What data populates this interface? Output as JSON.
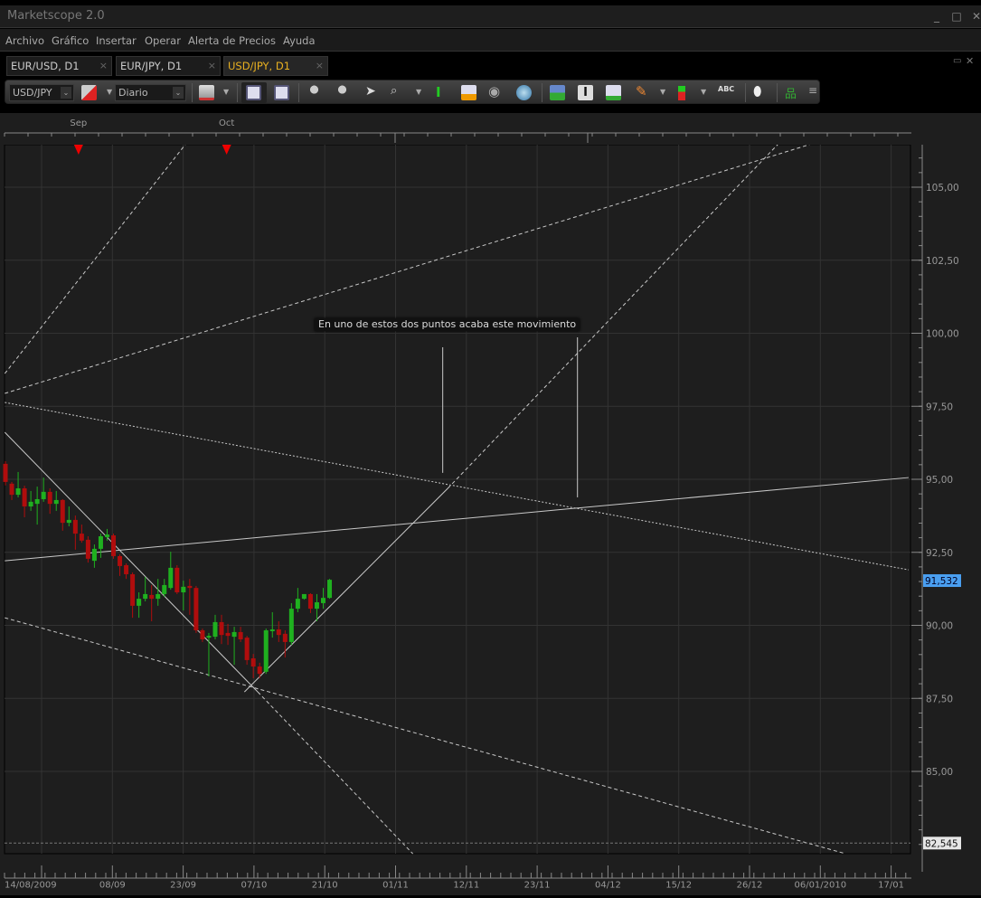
{
  "window": {
    "title": "Marketscope 2.0",
    "minimize": "_",
    "maximize": "□",
    "close": "✕"
  },
  "menu": [
    "Archivo",
    "Gráfico",
    "Insertar",
    "Operar",
    "Alerta de Precios",
    "Ayuda"
  ],
  "tabs": [
    {
      "label": "EUR/USD, D1",
      "active": false
    },
    {
      "label": "EUR/JPY, D1",
      "active": false
    },
    {
      "label": "USD/JPY, D1",
      "active": true
    }
  ],
  "tab_close": "×",
  "toolbar": {
    "symbol": "USD/JPY",
    "timeframe": "Diario",
    "dropdown": "⌄"
  },
  "colors": {
    "bull": "#1fb01f",
    "bear": "#b00d0d",
    "accent_tab": "#e8b020",
    "last_price_bg": "#4a9ff0",
    "line": "#c8c8c8",
    "grid": "#333333"
  },
  "chart_data": {
    "type": "candlestick",
    "symbol": "USD/JPY",
    "timeframe": "D1",
    "ylim": [
      82.1,
      106.5
    ],
    "y_ticks": [
      "105,00",
      "102,50",
      "100,00",
      "97,50",
      "95,00",
      "92,50",
      "90,00",
      "87,50",
      "85,00"
    ],
    "y_tick_values": [
      105,
      102.5,
      100,
      97.5,
      95,
      92.5,
      90,
      87.5,
      85
    ],
    "x_ticks": [
      "14/08/2009",
      "08/09",
      "23/09",
      "07/10",
      "21/10",
      "01/11",
      "12/11",
      "23/11",
      "04/12",
      "15/12",
      "26/12",
      "06/01/2010",
      "17/01"
    ],
    "top_months": [
      {
        "label": "Sep",
        "bar": 11.5
      },
      {
        "label": "Oct",
        "bar": 34.8
      }
    ],
    "last_price": "91,532",
    "last_price_value": 91.532,
    "hline_label": "82,545",
    "hline_value": 82.545,
    "annotation": {
      "text": "En uno de estos dos puntos acaba este movimiento",
      "bar": 70,
      "price": 100.29
    },
    "candles": [
      [
        95.53,
        95.62,
        94.79,
        94.91
      ],
      [
        94.85,
        94.91,
        94.29,
        94.47
      ],
      [
        94.47,
        95.25,
        94.38,
        94.69
      ],
      [
        94.69,
        94.78,
        93.7,
        94.07
      ],
      [
        94.07,
        94.6,
        93.92,
        94.23
      ],
      [
        94.16,
        94.75,
        93.45,
        94.32
      ],
      [
        94.32,
        95.06,
        94.23,
        94.57
      ],
      [
        94.57,
        94.69,
        93.82,
        94.16
      ],
      [
        94.16,
        94.6,
        93.92,
        94.29
      ],
      [
        94.29,
        94.32,
        93.24,
        93.51
      ],
      [
        93.51,
        94.07,
        93.39,
        93.61
      ],
      [
        93.61,
        93.76,
        92.59,
        93.14
      ],
      [
        93.14,
        93.45,
        92.83,
        92.9
      ],
      [
        92.93,
        93.05,
        92.15,
        92.28
      ],
      [
        92.21,
        92.77,
        91.97,
        92.62
      ],
      [
        92.62,
        93.14,
        92.31,
        93.05
      ],
      [
        93.02,
        93.3,
        92.9,
        93.11
      ],
      [
        93.08,
        93.14,
        92.28,
        92.37
      ],
      [
        92.37,
        92.43,
        91.69,
        92.03
      ],
      [
        92.06,
        92.12,
        91.59,
        91.75
      ],
      [
        91.75,
        91.81,
        90.26,
        90.67
      ],
      [
        90.67,
        91.13,
        90.26,
        90.91
      ],
      [
        90.91,
        91.66,
        90.82,
        91.07
      ],
      [
        91.04,
        91.38,
        90.14,
        90.91
      ],
      [
        90.91,
        91.59,
        90.67,
        91.07
      ],
      [
        91.07,
        91.59,
        90.98,
        91.38
      ],
      [
        91.28,
        92.52,
        91.22,
        91.97
      ],
      [
        91.97,
        92.06,
        91.07,
        91.13
      ],
      [
        91.13,
        91.53,
        90.51,
        91.32
      ],
      [
        91.35,
        91.59,
        90.36,
        91.28
      ],
      [
        91.28,
        91.35,
        89.74,
        89.83
      ],
      [
        89.83,
        89.89,
        89.43,
        89.52
      ],
      [
        89.58,
        89.74,
        88.25,
        89.64
      ],
      [
        89.61,
        90.36,
        89.52,
        90.11
      ],
      [
        90.11,
        90.36,
        89.36,
        89.67
      ],
      [
        89.74,
        90.05,
        89.33,
        89.64
      ],
      [
        89.61,
        89.95,
        88.65,
        89.77
      ],
      [
        89.77,
        89.95,
        89.43,
        89.52
      ],
      [
        89.58,
        89.64,
        88.65,
        88.81
      ],
      [
        88.87,
        89.02,
        88.19,
        88.59
      ],
      [
        88.59,
        88.72,
        88.19,
        88.34
      ],
      [
        88.41,
        89.89,
        88.34,
        89.83
      ],
      [
        89.8,
        90.45,
        89.58,
        89.86
      ],
      [
        89.86,
        90.14,
        89.43,
        89.67
      ],
      [
        89.71,
        89.83,
        88.9,
        89.43
      ],
      [
        89.43,
        90.76,
        89.33,
        90.57
      ],
      [
        90.57,
        91.28,
        90.45,
        90.91
      ],
      [
        90.91,
        91.07,
        90.88,
        91.07
      ],
      [
        91.07,
        91.1,
        90.42,
        90.57
      ],
      [
        90.57,
        91.07,
        90.14,
        90.79
      ],
      [
        90.76,
        91.28,
        90.57,
        90.94
      ],
      [
        90.94,
        91.59,
        90.91,
        91.56
      ]
    ],
    "trendlines": [
      {
        "from": [
          -0.1,
          98.62
        ],
        "to": [
          28.3,
          106.46
        ],
        "style": "dashed"
      },
      {
        "from": [
          -0.1,
          97.94
        ],
        "to": [
          126.5,
          106.46
        ],
        "style": "dashed"
      },
      {
        "from": [
          -0.1,
          97.63
        ],
        "to": [
          142.1,
          91.9
        ],
        "style": "dotted"
      },
      {
        "from": [
          -0.1,
          92.21
        ],
        "to": [
          142.1,
          95.06
        ],
        "style": "solid"
      },
      {
        "from": [
          -0.1,
          96.61
        ],
        "to": [
          39.7,
          87.72
        ],
        "style": "solid"
      },
      {
        "from": [
          39.7,
          87.72
        ],
        "to": [
          64.1,
          82.18
        ],
        "style": "dashed"
      },
      {
        "from": [
          37.6,
          87.72
        ],
        "to": [
          69.6,
          94.69
        ],
        "style": "solid"
      },
      {
        "from": [
          69.6,
          94.69
        ],
        "to": [
          121.5,
          106.46
        ],
        "style": "dashed"
      },
      {
        "from": [
          -0.1,
          90.26
        ],
        "to": [
          132.2,
          82.18
        ],
        "style": "dashed"
      },
      {
        "from": [
          68.8,
          99.52
        ],
        "to": [
          68.8,
          95.22
        ],
        "style": "solid"
      },
      {
        "from": [
          90.0,
          99.86
        ],
        "to": [
          90.0,
          94.38
        ],
        "style": "solid"
      }
    ]
  }
}
